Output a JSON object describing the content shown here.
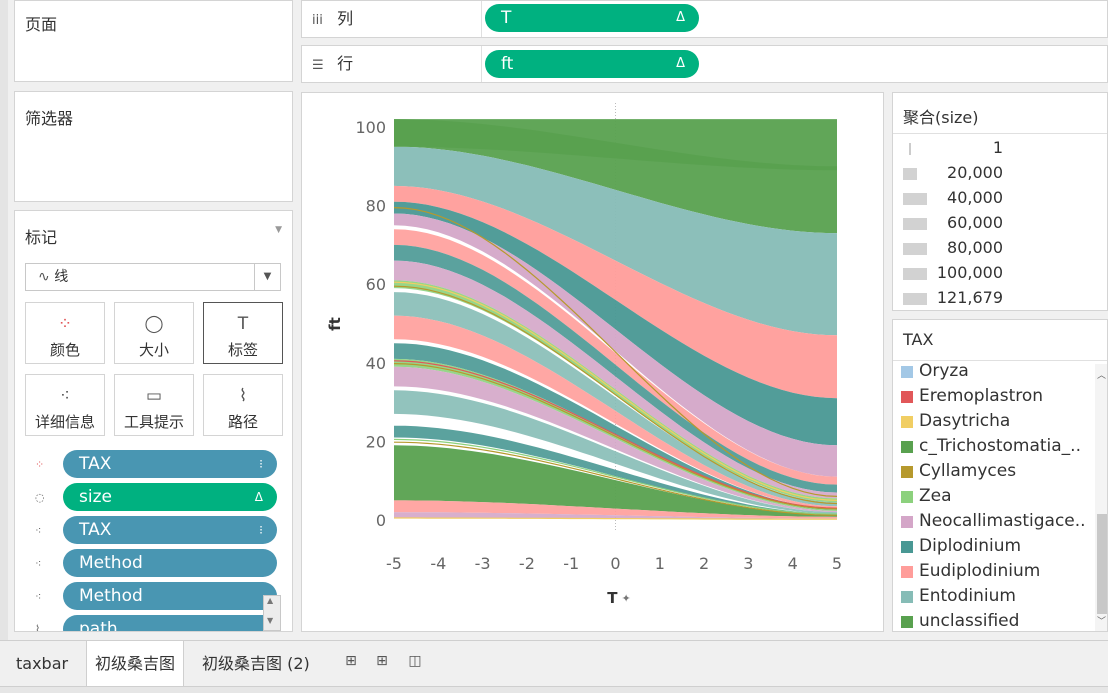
{
  "pages": {
    "title": "页面"
  },
  "filters": {
    "title": "筛选器"
  },
  "columns": {
    "label": "列",
    "pill": "T",
    "pill_icon": "Δ"
  },
  "rows": {
    "label": "行",
    "pill": "ft",
    "pill_icon": "Δ"
  },
  "marks": {
    "title": "标记",
    "mark_type": "线",
    "buttons": [
      {
        "label": "颜色",
        "icon": "color-dots-icon"
      },
      {
        "label": "大小",
        "icon": "size-icon"
      },
      {
        "label": "标签",
        "icon": "label-icon"
      },
      {
        "label": "详细信息",
        "icon": "detail-icon"
      },
      {
        "label": "工具提示",
        "icon": "tooltip-icon"
      },
      {
        "label": "路径",
        "icon": "path-icon"
      }
    ],
    "fields": [
      {
        "label": "TAX",
        "kind": "color",
        "color": "#4996b2",
        "tail": "⁝"
      },
      {
        "label": "size",
        "kind": "size",
        "color": "#00b180",
        "tail": "Δ"
      },
      {
        "label": "TAX",
        "kind": "detail",
        "color": "#4996b2",
        "tail": "⁝"
      },
      {
        "label": "Method",
        "kind": "detail",
        "color": "#4996b2",
        "tail": ""
      },
      {
        "label": "Method",
        "kind": "detail",
        "color": "#4996b2",
        "tail": ""
      },
      {
        "label": "path",
        "kind": "path",
        "color": "#4996b2",
        "tail": ""
      }
    ]
  },
  "size_legend": {
    "title": "聚合(size)",
    "items": [
      "1",
      "20,000",
      "40,000",
      "60,000",
      "80,000",
      "100,000",
      "121,679"
    ]
  },
  "tax_legend": {
    "title": "TAX",
    "items": [
      {
        "name": "Oryza",
        "color": "#a3c8e6"
      },
      {
        "name": "Eremoplastron",
        "color": "#e15759"
      },
      {
        "name": "Dasytricha",
        "color": "#f1ce63"
      },
      {
        "name": "c_Trichostomatia_..",
        "color": "#59a14f"
      },
      {
        "name": "Cyllamyces",
        "color": "#b6992d"
      },
      {
        "name": "Zea",
        "color": "#8cd17d"
      },
      {
        "name": "Neocallimastigace..",
        "color": "#d4a6c8"
      },
      {
        "name": "Diplodinium",
        "color": "#499894"
      },
      {
        "name": "Eudiplodinium",
        "color": "#ff9d9a"
      },
      {
        "name": "Entodinium",
        "color": "#86bcb6"
      },
      {
        "name": "unclassified",
        "color": "#59a14f"
      }
    ]
  },
  "chart_data": {
    "type": "area",
    "xlabel": "T",
    "ylabel": "ft",
    "xlim": [
      -5,
      5
    ],
    "ylim": [
      0,
      100
    ],
    "x_ticks": [
      -5,
      -4,
      -3,
      -2,
      -1,
      0,
      1,
      2,
      3,
      4,
      5
    ],
    "y_ticks": [
      0,
      20,
      40,
      60,
      80,
      100
    ],
    "ribbons": [
      {
        "tax": "unclassified",
        "color": "#59a14f",
        "y0": [
          102,
          95
        ],
        "y1": [
          102,
          73
        ],
        "opacity": 0.95
      },
      {
        "tax": "Entodinium",
        "color": "#86bcb6",
        "y0": [
          95,
          85
        ],
        "y1": [
          73,
          47
        ],
        "opacity": 0.95
      },
      {
        "tax": "Eudiplodinium",
        "color": "#ff9d9a",
        "y0": [
          85,
          81
        ],
        "y1": [
          47,
          31
        ],
        "opacity": 0.95
      },
      {
        "tax": "Diplodinium",
        "color": "#499894",
        "y0": [
          81,
          78
        ],
        "y1": [
          31,
          19
        ],
        "opacity": 0.95
      },
      {
        "tax": "Neocallimastigaceae",
        "color": "#d4a6c8",
        "y0": [
          78,
          75
        ],
        "y1": [
          19,
          11
        ],
        "opacity": 0.95
      },
      {
        "tax": "Eudiplodinium",
        "color": "#ff9d9a",
        "y0": [
          74,
          70
        ],
        "y1": [
          11,
          9
        ],
        "opacity": 0.9
      },
      {
        "tax": "Diplodinium",
        "color": "#499894",
        "y0": [
          70,
          66
        ],
        "y1": [
          9,
          7
        ],
        "opacity": 0.9
      },
      {
        "tax": "Neocallimastigaceae",
        "color": "#d4a6c8",
        "y0": [
          66,
          61
        ],
        "y1": [
          7,
          5.5
        ],
        "opacity": 0.9
      },
      {
        "tax": "Zea",
        "color": "#8cd17d",
        "y0": [
          61,
          59
        ],
        "y1": [
          5.5,
          4.5
        ],
        "opacity": 0.9
      },
      {
        "tax": "Entodinium",
        "color": "#86bcb6",
        "y0": [
          58,
          52
        ],
        "y1": [
          4.5,
          3.5
        ],
        "opacity": 0.9
      },
      {
        "tax": "Eudiplodinium",
        "color": "#ff9d9a",
        "y0": [
          52,
          46
        ],
        "y1": [
          3.5,
          3
        ],
        "opacity": 0.9
      },
      {
        "tax": "Diplodinium",
        "color": "#499894",
        "y0": [
          45,
          41
        ],
        "y1": [
          3,
          2.6
        ],
        "opacity": 0.9
      },
      {
        "tax": "Zea",
        "color": "#8cd17d",
        "y0": [
          41,
          39
        ],
        "y1": [
          2.6,
          2.3
        ],
        "opacity": 0.9
      },
      {
        "tax": "Neocallimastigaceae",
        "color": "#d4a6c8",
        "y0": [
          39,
          34
        ],
        "y1": [
          2.3,
          2
        ],
        "opacity": 0.9
      },
      {
        "tax": "Entodinium",
        "color": "#86bcb6",
        "y0": [
          33,
          27
        ],
        "y1": [
          2,
          1.6
        ],
        "opacity": 0.9
      },
      {
        "tax": "Diplodinium",
        "color": "#499894",
        "y0": [
          24,
          21
        ],
        "y1": [
          1.6,
          1.3
        ],
        "opacity": 0.9
      },
      {
        "tax": "unclassified",
        "color": "#59a14f",
        "y0": [
          19,
          5
        ],
        "y1": [
          1.3,
          0.8
        ],
        "opacity": 0.95
      },
      {
        "tax": "Eudiplodinium",
        "color": "#ff9d9a",
        "y0": [
          5,
          2
        ],
        "y1": [
          0.8,
          0.4
        ],
        "opacity": 0.9
      },
      {
        "tax": "Neocallimastigaceae",
        "color": "#d4a6c8",
        "y0": [
          2,
          0.5
        ],
        "y1": [
          0.4,
          0.1
        ],
        "opacity": 0.9
      },
      {
        "tax": "unclassified",
        "color": "#59a14f",
        "y0": [
          102,
          95
        ],
        "y1": [
          90,
          89
        ],
        "opacity": 0.9
      }
    ],
    "thin_lines": [
      {
        "color": "#b6992d",
        "y0": 79.5,
        "y1": 6
      },
      {
        "color": "#f1ce63",
        "y0": 60.5,
        "y1": 5
      },
      {
        "color": "#b6992d",
        "y0": 59.5,
        "y1": 4.2
      },
      {
        "color": "#e15759",
        "y0": 40.5,
        "y1": 3
      },
      {
        "color": "#b6992d",
        "y0": 39.8,
        "y1": 2.8
      },
      {
        "color": "#8cd17d",
        "y0": 20.5,
        "y1": 1.5
      },
      {
        "color": "#b6992d",
        "y0": 19.8,
        "y1": 1.2
      },
      {
        "color": "#f1ce63",
        "y0": 0.5,
        "y1": 0.2
      }
    ]
  },
  "tabs": [
    {
      "label": "taxbar",
      "active": false
    },
    {
      "label": "初级桑吉图",
      "active": true
    },
    {
      "label": "初级桑吉图 (2)",
      "active": false
    }
  ]
}
